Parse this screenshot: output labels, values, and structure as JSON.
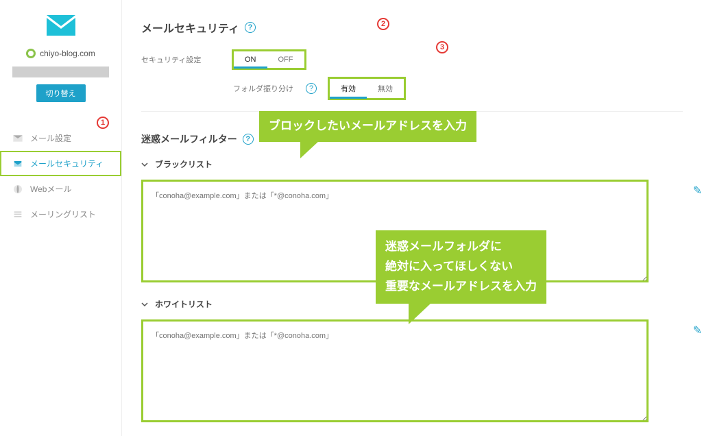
{
  "sidebar": {
    "site_name": "chiyo-blog.com",
    "switch_label": "切り替え",
    "items": [
      {
        "label": "メール設定"
      },
      {
        "label": "メールセキュリティ"
      },
      {
        "label": "Webメール"
      },
      {
        "label": "メーリングリスト"
      }
    ]
  },
  "header": {
    "title": "メールセキュリティ"
  },
  "security": {
    "label": "セキュリティ設定",
    "on": "ON",
    "off": "OFF",
    "folder_label": "フォルダ振り分け",
    "enabled": "有効",
    "disabled": "無効"
  },
  "filter": {
    "title": "迷惑メールフィルター",
    "blacklist_label": "ブラックリスト",
    "whitelist_label": "ホワイトリスト",
    "placeholder": "「conoha@example.com」または「*@conoha.com」"
  },
  "callouts": {
    "c1": "ブロックしたいメールアドレスを入力",
    "c2_line1": "迷惑メールフォルダに",
    "c2_line2": "絶対に入ってほしくない",
    "c2_line3": "重要なメールアドレスを入力"
  },
  "nums": {
    "n1": "1",
    "n2": "2",
    "n3": "3"
  }
}
